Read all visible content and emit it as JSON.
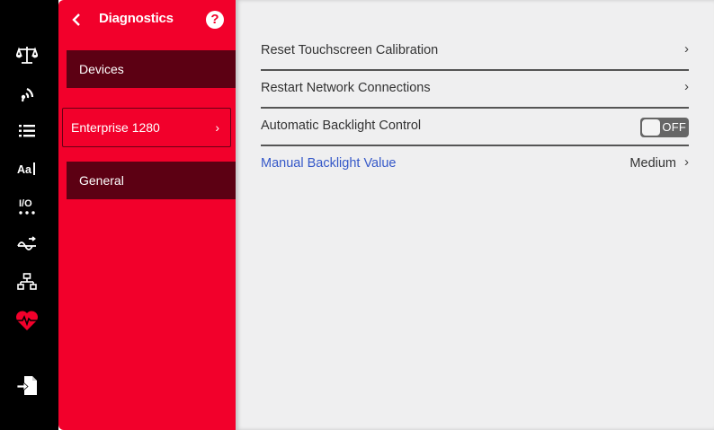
{
  "rail": {
    "icons": [
      {
        "name": "scale-icon",
        "color": "#ffffff"
      },
      {
        "name": "signal-icon",
        "color": "#ffffff"
      },
      {
        "name": "list-icon",
        "color": "#ffffff"
      },
      {
        "name": "text-size-icon",
        "label": "Aa",
        "color": "#ffffff"
      },
      {
        "name": "io-icon",
        "label": "I/O",
        "color": "#ffffff"
      },
      {
        "name": "signal-flow-icon",
        "color": "#ffffff"
      },
      {
        "name": "network-icon",
        "color": "#ffffff"
      },
      {
        "name": "heart-pulse-icon",
        "color": "#f2002b",
        "active": true
      },
      {
        "name": "export-file-icon",
        "color": "#ffffff"
      }
    ]
  },
  "panel": {
    "title": "Diagnostics",
    "help_label": "?",
    "items": [
      {
        "label": "Devices",
        "selected": false
      },
      {
        "label": "Enterprise 1280",
        "selected": true
      },
      {
        "label": "General",
        "selected": false
      }
    ],
    "accent_color": "#f2002b"
  },
  "settings": {
    "reset_touchscreen": {
      "label": "Reset Touchscreen Calibration"
    },
    "restart_network": {
      "label": "Restart Network Connections"
    },
    "auto_backlight": {
      "label": "Automatic Backlight Control",
      "toggle_state": "OFF"
    },
    "manual_backlight": {
      "label": "Manual Backlight Value",
      "value": "Medium",
      "link_color": "#3558c8"
    }
  }
}
